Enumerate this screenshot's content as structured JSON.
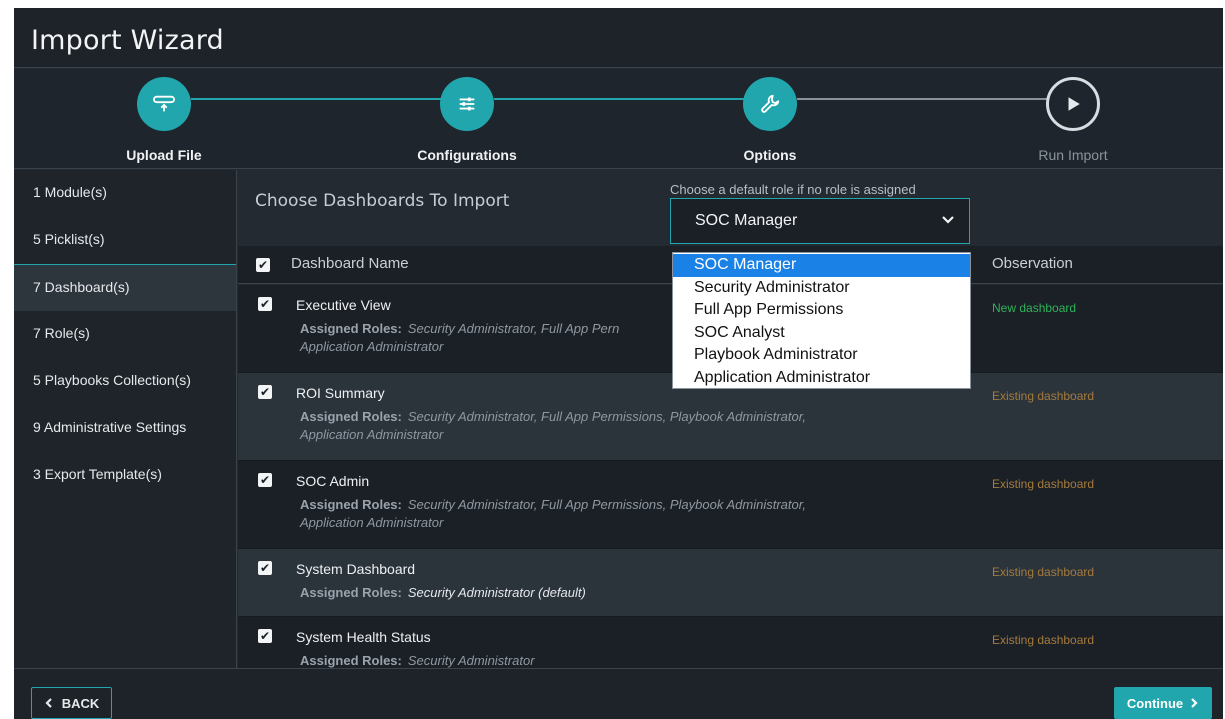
{
  "window": {
    "title": "Import Wizard"
  },
  "steps": [
    {
      "label": "Upload File",
      "state": "complete",
      "icon": "upload-file-icon"
    },
    {
      "label": "Configurations",
      "state": "complete",
      "icon": "sliders-icon"
    },
    {
      "label": "Options",
      "state": "active",
      "icon": "wrench-icon"
    },
    {
      "label": "Run Import",
      "state": "pending",
      "icon": "play-icon"
    }
  ],
  "sidebar": {
    "items": [
      {
        "label": "1 Module(s)"
      },
      {
        "label": "5 Picklist(s)"
      },
      {
        "label": "7 Dashboard(s)",
        "active": true
      },
      {
        "label": "7 Role(s)"
      },
      {
        "label": "5 Playbooks Collection(s)"
      },
      {
        "label": "9 Administrative Settings"
      },
      {
        "label": "3 Export Template(s)"
      }
    ]
  },
  "main": {
    "title": "Choose Dashboards To Import",
    "role_hint": "Choose a default role if no role is assigned",
    "role_select": {
      "value": "SOC Manager",
      "options": [
        "SOC Manager",
        "Security Administrator",
        "Full App Permissions",
        "SOC Analyst",
        "Playbook Administrator",
        "Application Administrator"
      ]
    },
    "table": {
      "columns": {
        "name": "Dashboard Name",
        "observation": "Observation"
      },
      "roles_label": "Assigned Roles:",
      "rows": [
        {
          "name": "Executive View",
          "roles": "Security Administrator, Full App Pern",
          "roles_line2": "Application Administrator",
          "observation": "New dashboard",
          "obs_color": "#2fb35a"
        },
        {
          "name": "ROI Summary",
          "roles": "Security Administrator, Full App Permissions, Playbook Administrator,",
          "roles_line2": "Application Administrator",
          "observation": "Existing dashboard",
          "obs_color": "#a67b3c"
        },
        {
          "name": "SOC Admin",
          "roles": "Security Administrator, Full App Permissions, Playbook Administrator,",
          "roles_line2": "Application Administrator",
          "observation": "Existing dashboard",
          "obs_color": "#a67b3c"
        },
        {
          "name": "System Dashboard",
          "roles": "Security Administrator (default)",
          "observation": "Existing dashboard",
          "obs_color": "#a67b3c"
        },
        {
          "name": "System Health Status",
          "roles": "Security Administrator",
          "observation": "Existing dashboard",
          "obs_color": "#a67b3c"
        }
      ]
    }
  },
  "footer": {
    "back_label": "BACK",
    "continue_label": "Continue"
  },
  "colors": {
    "accent": "#21a6ad",
    "selected": "#1a82e6",
    "new": "#2fb35a",
    "existing": "#a67b3c"
  }
}
